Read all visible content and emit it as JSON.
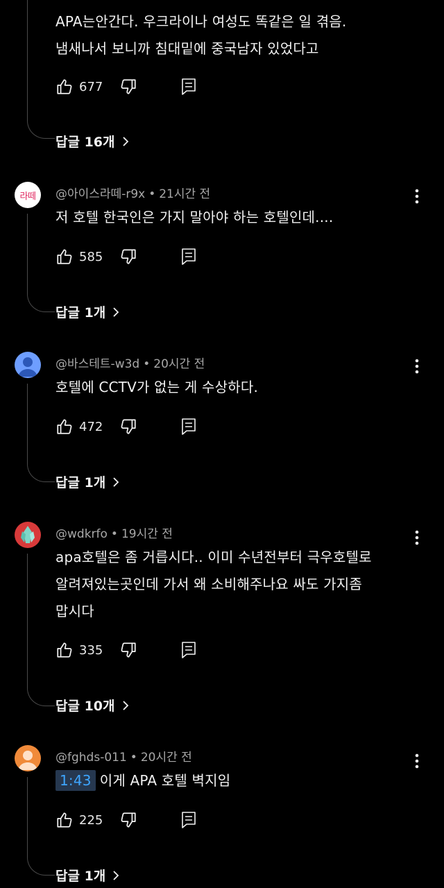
{
  "comments": [
    {
      "author": "",
      "time": "",
      "lines": [
        "APA는안간다. 우크라이나 여성도 똑같은 일 겪음.",
        "냄새나서 보니까 침대밑에 중국남자 있었다고"
      ],
      "likes": "677",
      "replies_label": "답글 16개"
    },
    {
      "author": "@아이스라떼-r9x",
      "time": "21시간 전",
      "avatar_text": "라떼",
      "avatar_color": "#ffffff",
      "avatar_text_color": "#e0245e",
      "lines": [
        "저 호텔 한국인은 가지 말아야 하는 호텔인데...."
      ],
      "likes": "585",
      "replies_label": "답글 1개"
    },
    {
      "author": "@바스테트-w3d",
      "time": "20시간 전",
      "avatar_color": "#6e9eff",
      "lines": [
        "호텔에 CCTV가 없는 게 수상하다."
      ],
      "likes": "472",
      "replies_label": "답글 1개"
    },
    {
      "author": "@wdkrfo",
      "time": "19시간 전",
      "avatar_color": "#d83a3a",
      "lines": [
        "apa호텔은 좀 거릅시다.. 이미 수년전부터 극우호텔로",
        "알려져있는곳인데 가서 왜 소비해주나요 싸도 가지좀",
        "맙시다"
      ],
      "likes": "335",
      "replies_label": "답글 10개"
    },
    {
      "author": "@fghds-011",
      "time": "20시간 전",
      "avatar_color": "#f08a3a",
      "timestamp": "1:43",
      "lines": [
        "이게 APA 호텔 벽지임"
      ],
      "likes": "225",
      "replies_label": "답글 1개"
    }
  ],
  "icons": {
    "like": "thumb-up-icon",
    "dislike": "thumb-down-icon",
    "reply": "reply-comment-icon",
    "menu": "more-vert-icon",
    "chevron": "chevron-right-icon"
  }
}
